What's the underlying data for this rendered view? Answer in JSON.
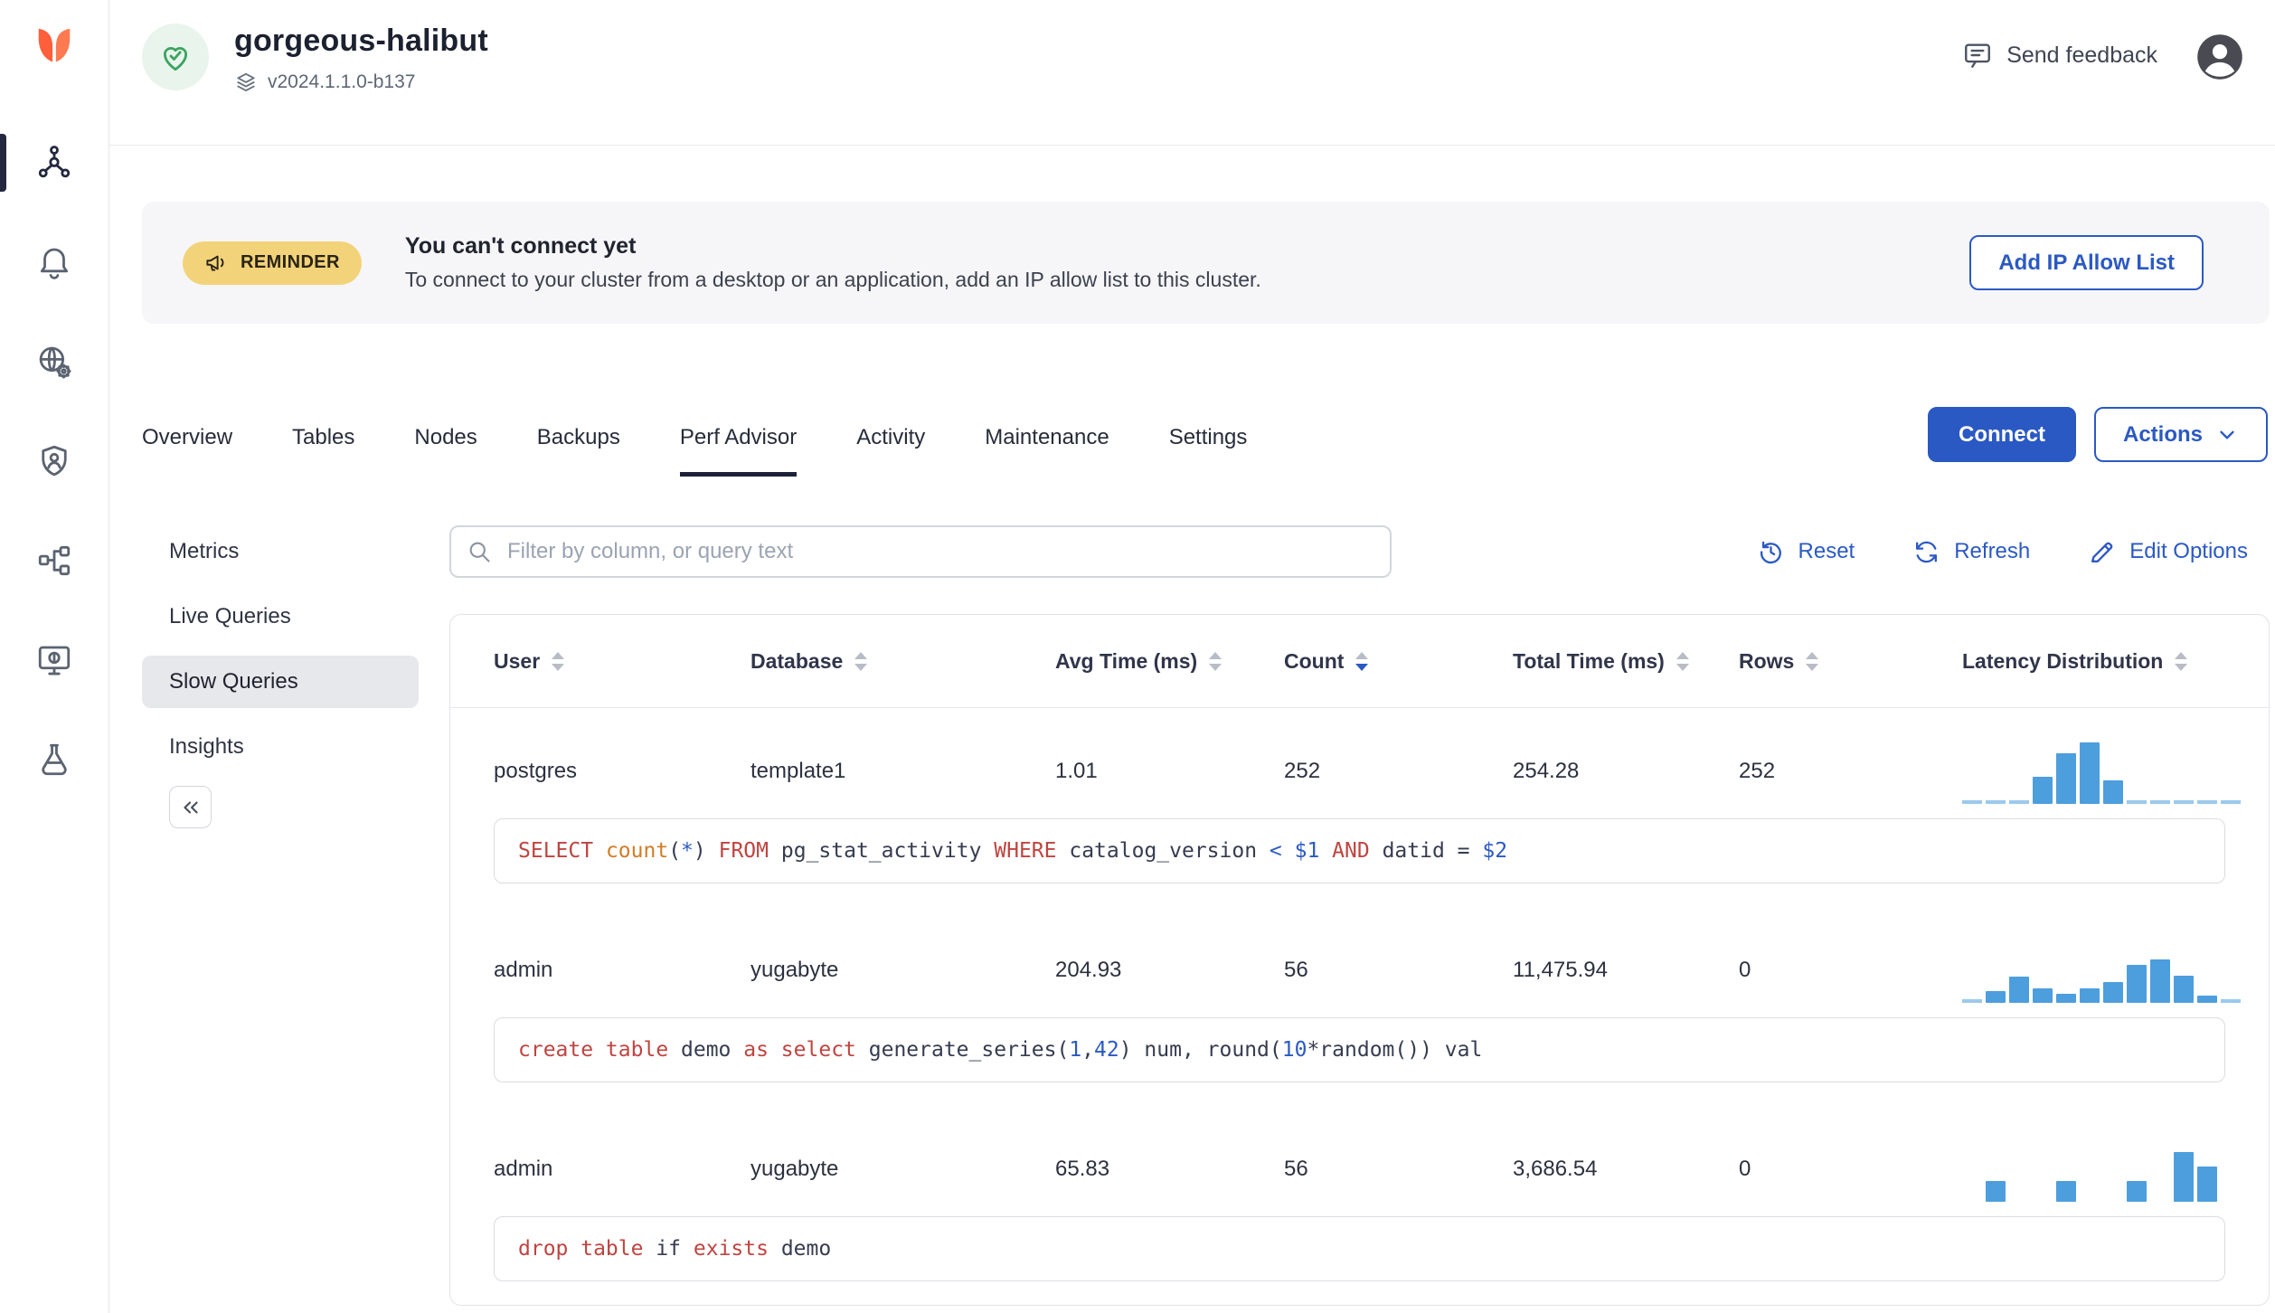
{
  "colors": {
    "accent_blue": "#2B59C3",
    "brand_orange": "#FF5F3B",
    "active_navy": "#1C2138",
    "reminder_pill_bg": "#F3D37A",
    "banner_bg": "#F6F6F8",
    "histogram_bar": "#4D9EDD",
    "health_green": "#3BA45F",
    "keyword_red": "#BF4440",
    "function_orange": "#D07D27"
  },
  "sidebar": {
    "items": [
      {
        "icon": "cluster",
        "active": true
      },
      {
        "icon": "bell",
        "active": false
      },
      {
        "icon": "globe-gear",
        "active": false
      },
      {
        "icon": "shield-user",
        "active": false
      },
      {
        "icon": "topology",
        "active": false
      },
      {
        "icon": "monitor-coin",
        "active": false
      },
      {
        "icon": "flask",
        "active": false
      }
    ]
  },
  "header": {
    "cluster_name": "gorgeous-halibut",
    "version": "v2024.1.1.0-b137",
    "feedback_label": "Send feedback"
  },
  "banner": {
    "badge": "REMINDER",
    "title": "You can't connect yet",
    "message": "To connect to your cluster from a desktop or an application, add an IP allow list to this cluster.",
    "action_label": "Add IP Allow List"
  },
  "tabs": {
    "items": [
      "Overview",
      "Tables",
      "Nodes",
      "Backups",
      "Perf Advisor",
      "Activity",
      "Maintenance",
      "Settings"
    ],
    "active": "Perf Advisor"
  },
  "actions": {
    "connect": "Connect",
    "actions": "Actions"
  },
  "subnav": {
    "items": [
      "Metrics",
      "Live Queries",
      "Slow Queries",
      "Insights"
    ],
    "active": "Slow Queries"
  },
  "toolbar": {
    "filter_placeholder": "Filter by column, or query text",
    "reset": "Reset",
    "refresh": "Refresh",
    "edit_options": "Edit Options"
  },
  "table": {
    "columns": [
      {
        "label": "User",
        "sort": "none"
      },
      {
        "label": "Database",
        "sort": "none"
      },
      {
        "label": "Avg Time (ms)",
        "sort": "none"
      },
      {
        "label": "Count",
        "sort": "desc"
      },
      {
        "label": "Total Time (ms)",
        "sort": "none"
      },
      {
        "label": "Rows",
        "sort": "none"
      },
      {
        "label": "Latency Distribution",
        "sort": "none"
      }
    ],
    "rows": [
      {
        "user": "postgres",
        "database": "template1",
        "avg_time": "1.01",
        "count": "252",
        "total_time": "254.28",
        "rows": "252",
        "histogram": [
          3,
          3,
          3,
          30,
          56,
          68,
          26,
          3,
          3,
          3,
          3,
          3
        ],
        "query_tokens": [
          {
            "t": "SELECT ",
            "c": "kw"
          },
          {
            "t": "count",
            "c": "fn"
          },
          {
            "t": "(",
            "c": "p"
          },
          {
            "t": "*",
            "c": "num"
          },
          {
            "t": ") ",
            "c": "p"
          },
          {
            "t": "FROM ",
            "c": "kw"
          },
          {
            "t": "pg_stat_activity ",
            "c": "p"
          },
          {
            "t": "WHERE ",
            "c": "kw"
          },
          {
            "t": "catalog_version ",
            "c": "p"
          },
          {
            "t": "< ",
            "c": "num"
          },
          {
            "t": "$1 ",
            "c": "num"
          },
          {
            "t": "AND ",
            "c": "kw"
          },
          {
            "t": "datid = ",
            "c": "p"
          },
          {
            "t": "$2",
            "c": "num"
          }
        ]
      },
      {
        "user": "admin",
        "database": "yugabyte",
        "avg_time": "204.93",
        "count": "56",
        "total_time": "11,475.94",
        "rows": "0",
        "histogram": [
          3,
          13,
          29,
          16,
          10,
          16,
          23,
          42,
          48,
          30,
          8,
          3
        ],
        "query_tokens": [
          {
            "t": "create table ",
            "c": "kw"
          },
          {
            "t": "demo ",
            "c": "p"
          },
          {
            "t": "as select ",
            "c": "kw"
          },
          {
            "t": "generate_series(",
            "c": "p"
          },
          {
            "t": "1",
            "c": "num"
          },
          {
            "t": ",",
            "c": "p"
          },
          {
            "t": "42",
            "c": "num"
          },
          {
            "t": ") num, round(",
            "c": "p"
          },
          {
            "t": "10",
            "c": "num"
          },
          {
            "t": "*random()) val",
            "c": "p"
          }
        ]
      },
      {
        "user": "admin",
        "database": "yugabyte",
        "avg_time": "65.83",
        "count": "56",
        "total_time": "3,686.54",
        "rows": "0",
        "histogram": [
          0,
          23,
          0,
          0,
          23,
          0,
          0,
          23,
          0,
          55,
          39,
          0
        ],
        "query_tokens": [
          {
            "t": "drop table ",
            "c": "kw"
          },
          {
            "t": "if ",
            "c": "p"
          },
          {
            "t": "exists ",
            "c": "kw"
          },
          {
            "t": "demo",
            "c": "p"
          }
        ]
      }
    ]
  }
}
